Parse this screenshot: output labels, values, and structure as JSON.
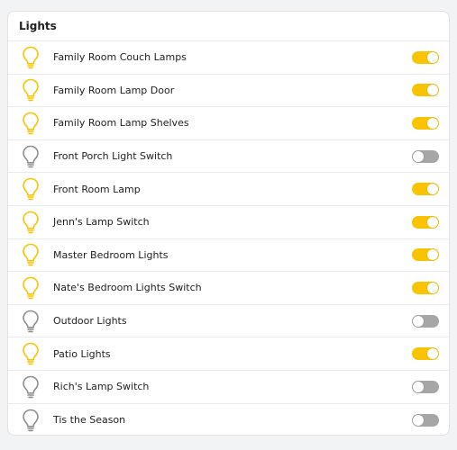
{
  "card": {
    "title": "Lights"
  },
  "colors": {
    "on": "#f8c400",
    "off": "#8e8e8e",
    "toggle_off": "#a6a6a6"
  },
  "lights": [
    {
      "name": "Family Room Couch Lamps",
      "on": true,
      "icon": "lightbulb-icon"
    },
    {
      "name": "Family Room Lamp Door",
      "on": true,
      "icon": "lightbulb-icon"
    },
    {
      "name": "Family Room Lamp Shelves",
      "on": true,
      "icon": "lightbulb-icon"
    },
    {
      "name": "Front Porch Light Switch",
      "on": false,
      "icon": "lightbulb-icon"
    },
    {
      "name": "Front Room Lamp",
      "on": true,
      "icon": "lightbulb-icon"
    },
    {
      "name": "Jenn's Lamp Switch",
      "on": true,
      "icon": "lightbulb-icon"
    },
    {
      "name": "Master Bedroom Lights",
      "on": true,
      "icon": "lightbulb-icon"
    },
    {
      "name": "Nate's Bedroom Lights Switch",
      "on": true,
      "icon": "lightbulb-icon"
    },
    {
      "name": "Outdoor Lights",
      "on": false,
      "icon": "lightbulb-icon"
    },
    {
      "name": "Patio Lights",
      "on": true,
      "icon": "lightbulb-icon"
    },
    {
      "name": "Rich's Lamp Switch",
      "on": false,
      "icon": "lightbulb-icon"
    },
    {
      "name": "Tis the Season",
      "on": false,
      "icon": "lightbulb-icon"
    }
  ]
}
